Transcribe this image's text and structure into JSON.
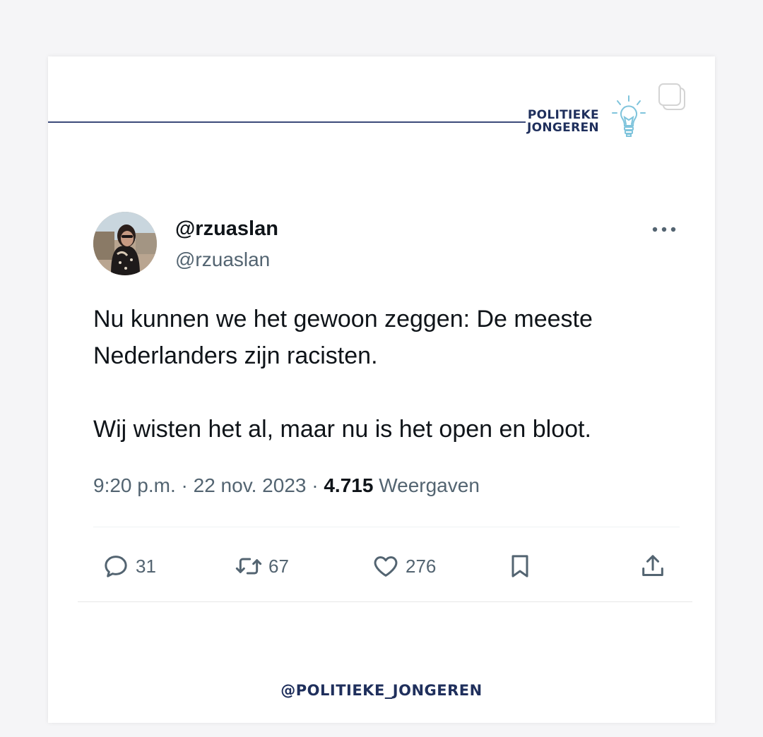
{
  "brand": {
    "line1": "POLITIEKE",
    "line2": "JONGEREN"
  },
  "tweet": {
    "display_name": "@rzuaslan",
    "handle": "@rzuaslan",
    "paragraphs": [
      "Nu kunnen we het gewoon zeggen: De meeste Nederlanders zijn racisten.",
      "Wij wisten het al, maar nu is het open en bloot."
    ],
    "time": "9:20 p.m.",
    "separator": "·",
    "date": "22 nov. 2023",
    "views_count": "4.715",
    "views_label": "Weergaven"
  },
  "actions": {
    "replies": "31",
    "retweets": "67",
    "likes": "276"
  },
  "footer": {
    "handle": "@POLITIEKE_JONGEREN"
  },
  "icons": [
    "multiple-posts-icon",
    "lightbulb-icon",
    "more-options-icon",
    "reply-icon",
    "retweet-icon",
    "like-icon",
    "bookmark-icon",
    "share-icon"
  ],
  "colors": {
    "brand_navy": "#1f2f5c",
    "text_primary": "#0f1419",
    "text_secondary": "#536471",
    "bulb_blue": "#7fc4dc"
  }
}
